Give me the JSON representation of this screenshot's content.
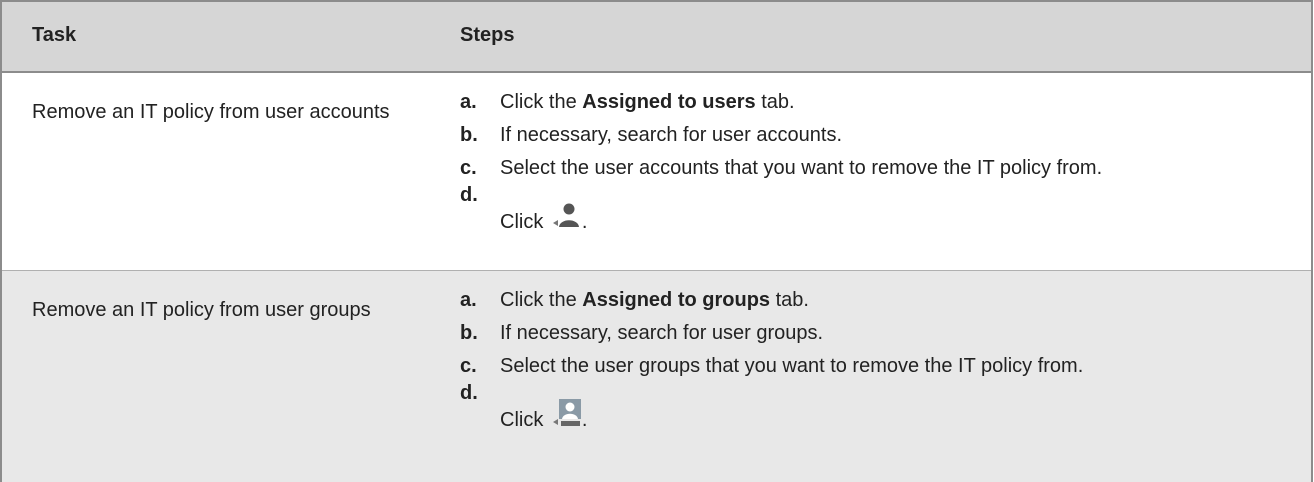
{
  "header": {
    "task": "Task",
    "steps": "Steps"
  },
  "rows": [
    {
      "task": "Remove an IT policy from user accounts",
      "steps": [
        {
          "label": "a.",
          "pre": "Click the ",
          "bold": "Assigned to users",
          "post": " tab."
        },
        {
          "label": "b.",
          "text": "If necessary, search for user accounts."
        },
        {
          "label": "c.",
          "text": "Select the user accounts that you want to remove the IT policy from."
        },
        {
          "label": "d.",
          "pre": "Click ",
          "post": ".",
          "icon": "remove-user-icon"
        }
      ]
    },
    {
      "task": "Remove an IT policy from user groups",
      "steps": [
        {
          "label": "a.",
          "pre": "Click the ",
          "bold": "Assigned to groups",
          "post": " tab."
        },
        {
          "label": "b.",
          "text": "If necessary, search for user groups."
        },
        {
          "label": "c.",
          "text": "Select the user groups that you want to remove the IT policy from."
        },
        {
          "label": "d.",
          "pre": "Click ",
          "post": ".",
          "icon": "remove-group-icon"
        }
      ]
    }
  ]
}
